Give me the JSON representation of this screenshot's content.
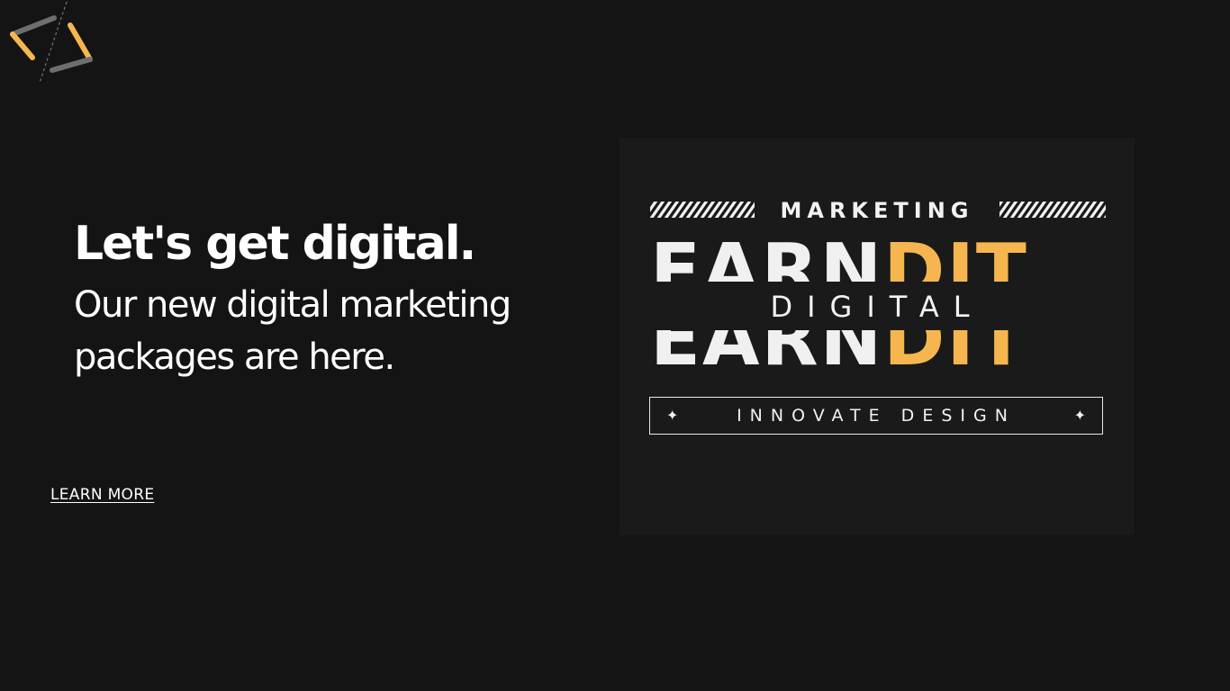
{
  "colors": {
    "background": "#141414",
    "card_background": "#1a1a1a",
    "accent": "#f6b64f",
    "text": "#ffffff"
  },
  "logo": {
    "icon": "code-bracket-logo-icon"
  },
  "hero": {
    "title": "Let's get digital.",
    "subtitle": "Our new digital marketing packages are here."
  },
  "cta": {
    "learn_more": "LEARN MORE"
  },
  "promo": {
    "top_label": "MARKETING",
    "big_word_light": "EARN",
    "big_word_accent": "DIT",
    "middle_label": "DIGITAL",
    "bottom_label": "INNOVATE DESIGN",
    "sparkle_icon": "sparkle-icon"
  }
}
